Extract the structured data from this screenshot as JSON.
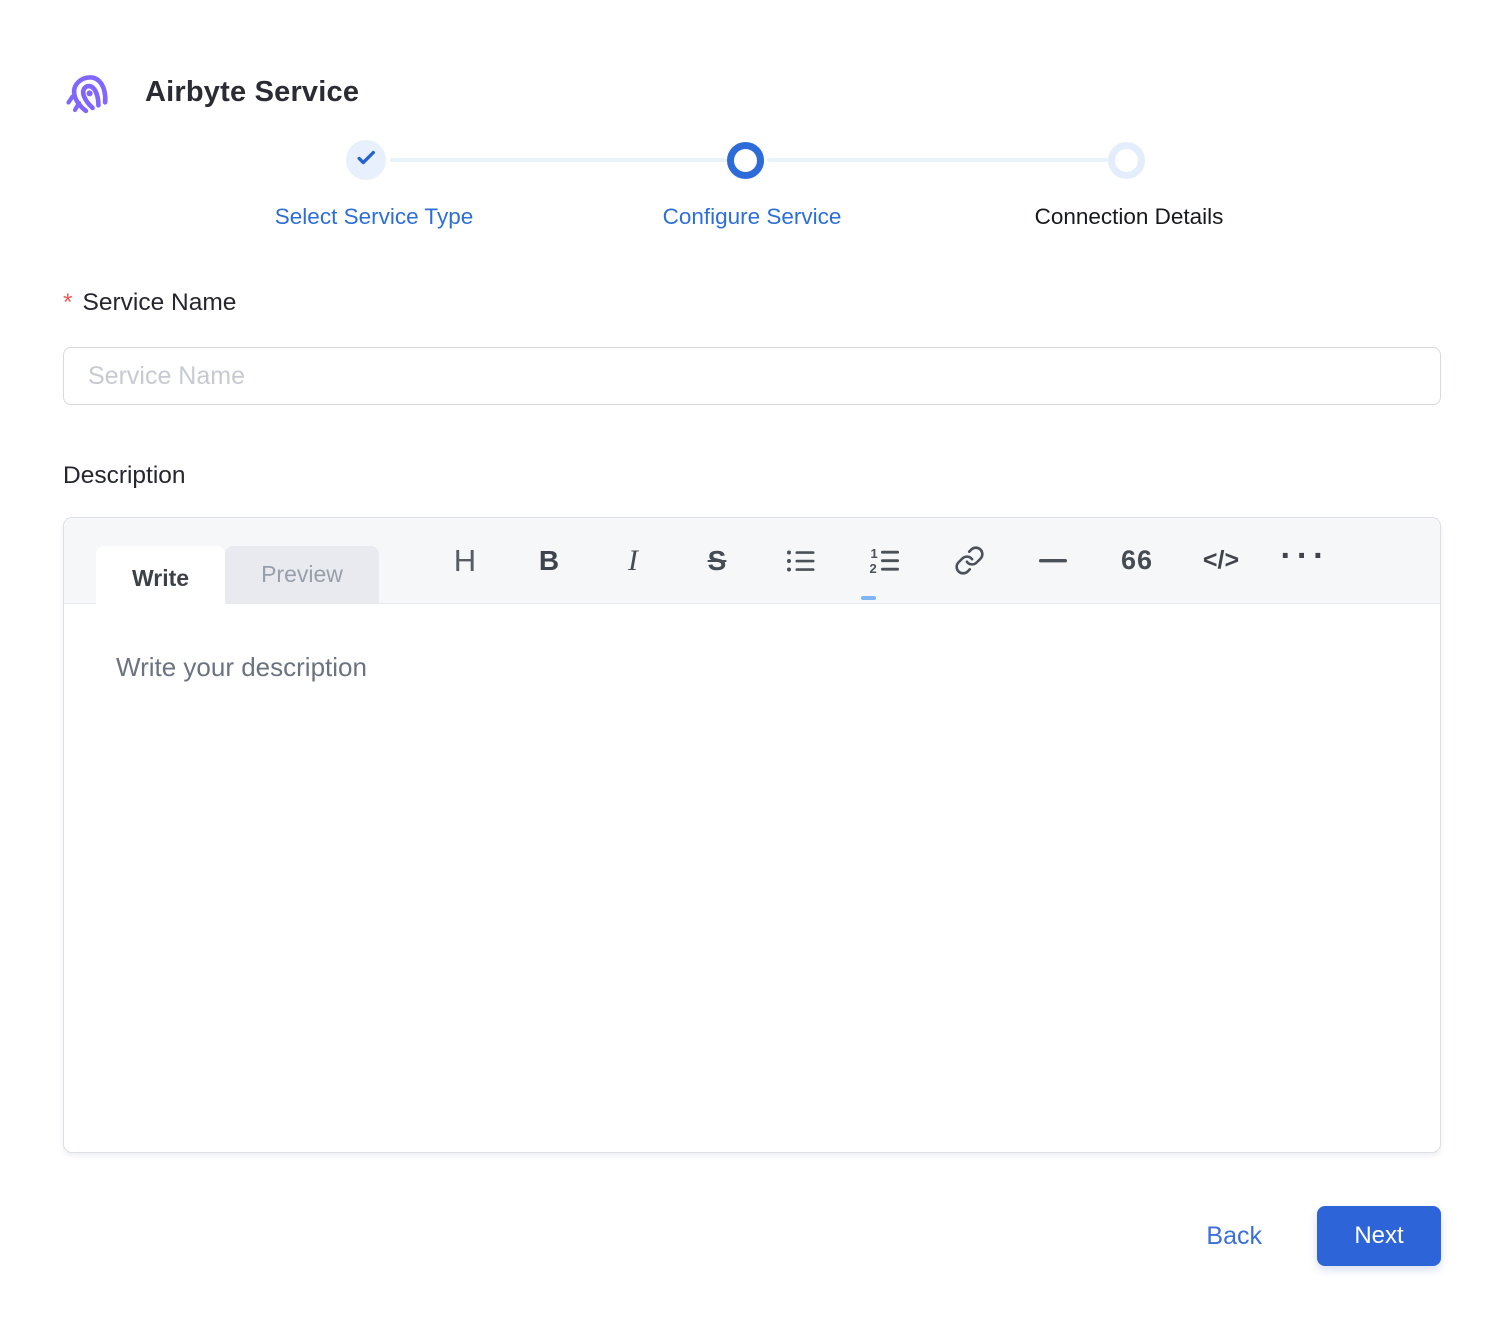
{
  "header": {
    "title": "Airbyte Service",
    "logo": "airbyte-octopus-logo"
  },
  "stepper": {
    "steps": [
      {
        "label": "Select Service Type",
        "state": "completed",
        "icon": "check-icon"
      },
      {
        "label": "Configure Service",
        "state": "current"
      },
      {
        "label": "Connection Details",
        "state": "upcoming"
      }
    ]
  },
  "form": {
    "service_name": {
      "label": "Service Name",
      "required_marker": "*",
      "value": "",
      "placeholder": "Service Name"
    },
    "description": {
      "label": "Description",
      "value": "",
      "placeholder": "Write your description"
    }
  },
  "editor": {
    "tabs": [
      {
        "label": "Write",
        "active": true
      },
      {
        "label": "Preview",
        "active": false
      }
    ],
    "toolbar": [
      {
        "name": "heading-icon",
        "glyph": "H"
      },
      {
        "name": "bold-icon",
        "glyph": "B"
      },
      {
        "name": "italic-icon",
        "glyph": "I"
      },
      {
        "name": "strikethrough-icon",
        "glyph": "S"
      },
      {
        "name": "unordered-list-icon"
      },
      {
        "name": "ordered-list-icon"
      },
      {
        "name": "link-icon"
      },
      {
        "name": "horizontal-rule-icon"
      },
      {
        "name": "quote-icon",
        "glyph": "66"
      },
      {
        "name": "code-icon",
        "glyph": "</>"
      },
      {
        "name": "more-icon",
        "glyph": "···"
      }
    ]
  },
  "footer": {
    "back_label": "Back",
    "next_label": "Next"
  },
  "colors": {
    "accent_blue": "#2D64D8",
    "stepper_blue": "#2D6FD9",
    "light_blue_fill": "#E7F0FC",
    "light_blue_ring": "#E3EDFB",
    "logo_purple": "#8066FF",
    "required_red": "#EC5B56"
  }
}
